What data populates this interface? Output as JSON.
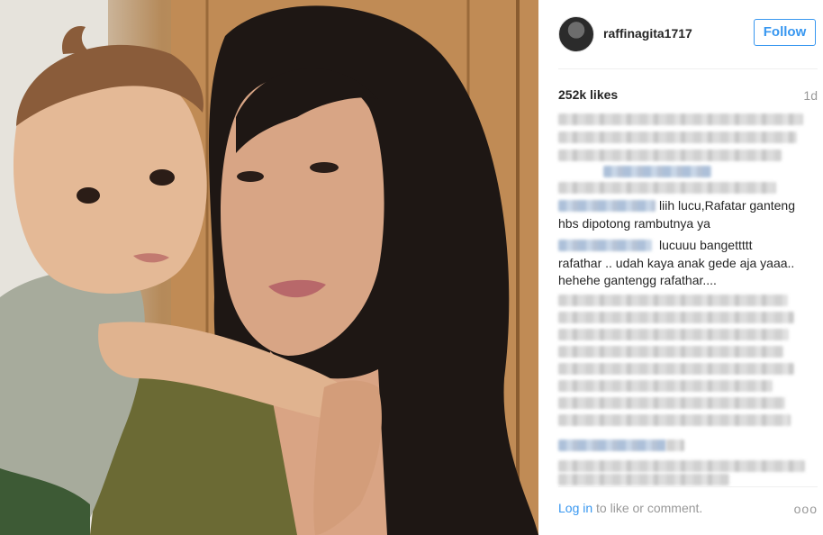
{
  "post": {
    "username": "raffinagita1717",
    "follow_label": "Follow",
    "likes": "252k likes",
    "time": "1d"
  },
  "comments": [
    {
      "text_line1": "liih lucu,Rafatar ganteng",
      "text_line2": "hbs dipotong rambutnya ya"
    },
    {
      "text_line1": "lucuuu bangettttt",
      "text_line2": "rafathar .. udah kaya anak gede aja yaaa..",
      "text_line3": "hehehe gantengg rafathar...."
    }
  ],
  "footer": {
    "login_label": "Log in",
    "comment_prompt": "to like or comment.",
    "more_icon": "ooo"
  },
  "icons": {
    "more": "more-options-icon",
    "avatar": "user-avatar"
  },
  "colors": {
    "link": "#3897f0",
    "text": "#262626",
    "muted": "#999999"
  }
}
